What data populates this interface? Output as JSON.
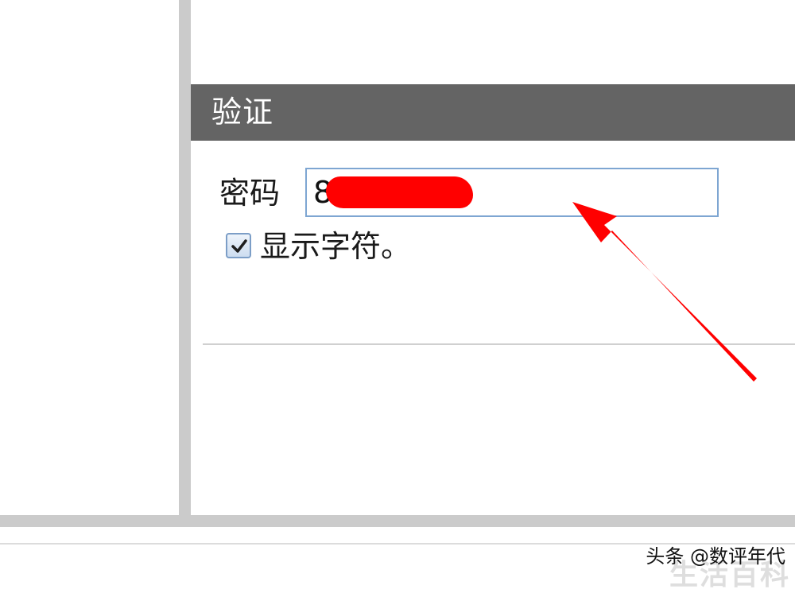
{
  "dialog": {
    "section_title": "验证",
    "password_label": "密码",
    "password_value": "8",
    "show_chars_label": "显示字符。",
    "show_chars_checked": true
  },
  "watermark": {
    "source": "头条 @数评年代",
    "faint_text": "生活百科"
  },
  "colors": {
    "header_bg": "#646464",
    "divider": "#cbcbcb",
    "field_border": "#7ea6d2",
    "annotation": "#ff0000"
  },
  "icons": {
    "checkbox": "check-icon",
    "annotation": "red-arrow-icon"
  }
}
